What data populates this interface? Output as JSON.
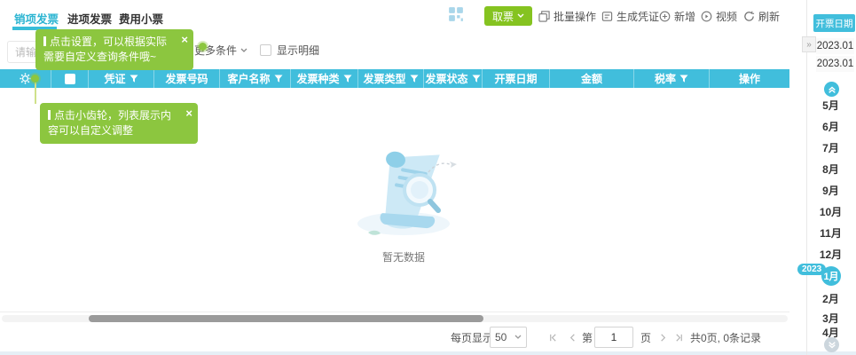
{
  "tabs": {
    "items": [
      {
        "label": "销项发票"
      },
      {
        "label": "进项发票"
      },
      {
        "label": "费用小票"
      }
    ]
  },
  "toolbar": {
    "get_ticket": "取票",
    "batch_ops": "批量操作",
    "gen_voucher": "生成凭证",
    "add_new": "新增",
    "video": "视频",
    "refresh": "刷新"
  },
  "filters": {
    "search_placeholder": "请输入",
    "more_conditions": "更多条件",
    "show_detail": "显示明细"
  },
  "tooltips": {
    "settings": {
      "text": "点击设置，可以根据实际需要自定义查询条件哦~",
      "close": "×"
    },
    "gear": {
      "text": "点击小齿轮，列表展示内容可以自定义调整",
      "close": "×"
    }
  },
  "table": {
    "columns": [
      {
        "label": "凭证",
        "filter": true
      },
      {
        "label": "发票号码",
        "filter": false
      },
      {
        "label": "客户名称",
        "filter": true
      },
      {
        "label": "发票种类",
        "filter": true
      },
      {
        "label": "发票类型",
        "filter": true
      },
      {
        "label": "发票状态",
        "filter": true
      },
      {
        "label": "开票日期",
        "filter": false
      },
      {
        "label": "金额",
        "filter": false
      },
      {
        "label": "税率",
        "filter": true
      },
      {
        "label": "操作",
        "filter": false
      }
    ],
    "empty_text": "暂无数据"
  },
  "pagination": {
    "per_page_label": "每页显示",
    "per_page_value": "50",
    "page_prefix": "第",
    "page_value": "1",
    "page_suffix": "页",
    "summary": "共0页, 0条记录"
  },
  "date_panel": {
    "title": "开票日期",
    "collapse": "»",
    "date_start": "2023.01",
    "date_end": "2023.01",
    "year_badge": "2023",
    "months": [
      "5月",
      "6月",
      "7月",
      "8月",
      "9月",
      "10月",
      "11月",
      "12月",
      "1月",
      "2月",
      "3月",
      "4月"
    ],
    "active_month": "1月"
  },
  "colors": {
    "teal": "#41bedc",
    "tab_active": "#2db5d2",
    "tooltip_green": "#8cc63f",
    "button_green": "#85c320",
    "scrollbar_thumb": "#9b9b9b"
  }
}
